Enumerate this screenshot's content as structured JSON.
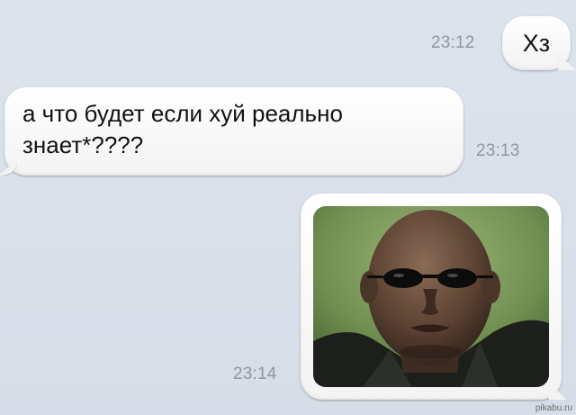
{
  "conversation": {
    "messages": [
      {
        "sender": "me",
        "text": "Хз",
        "time": "23:12"
      },
      {
        "sender": "them",
        "line1": "а что будет если хуй реально",
        "line2": "знает*????",
        "time": "23:13"
      },
      {
        "sender": "me",
        "type": "image",
        "image_name": "photo-of-man-in-sunglasses",
        "time": "23:14"
      }
    ]
  },
  "watermark": "pikabu.ru",
  "colors": {
    "background": "#d9e0ea",
    "bubble": "#ffffff",
    "timestamp": "#8e96a2",
    "photo_background": "#6f8e4f"
  }
}
